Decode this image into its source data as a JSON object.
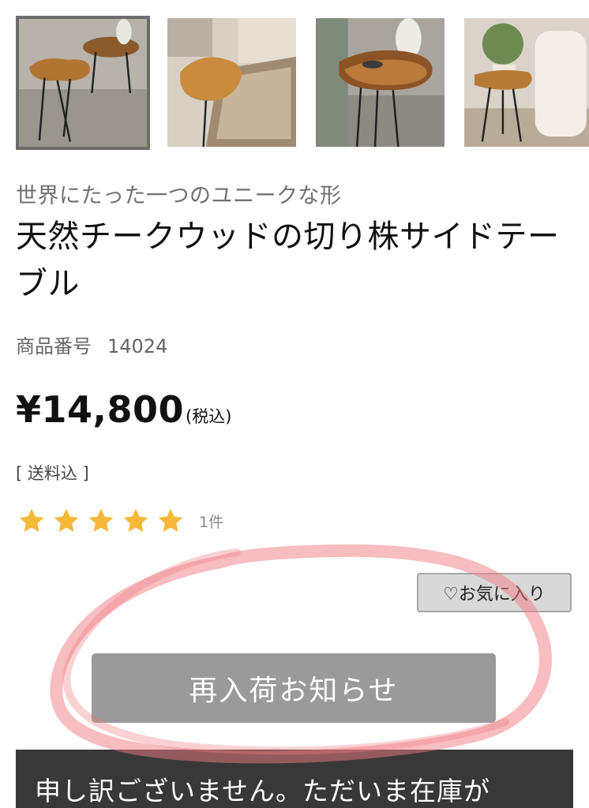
{
  "gallery": {
    "thumbnails": [
      {
        "icon": "photo-two-tables",
        "selected": true
      },
      {
        "icon": "photo-table-on-rug",
        "selected": false
      },
      {
        "icon": "photo-table-closeup",
        "selected": false
      },
      {
        "icon": "photo-table-with-person",
        "selected": false
      }
    ]
  },
  "product": {
    "subtitle": "世界にたった一つのユニークな形",
    "title": "天然チークウッドの切り株サイドテーブル",
    "number_label": "商品番号",
    "number": "14024",
    "price": "¥14,800",
    "tax_note": "(税込)",
    "shipping": "[ 送料込 ]",
    "rating": 5,
    "review_count": "1件"
  },
  "actions": {
    "favorite_label": "♡お気に入り",
    "restock_label": "再入荷お知らせ"
  },
  "notice": {
    "text": "申し訳ございません。ただいま在庫が"
  },
  "colors": {
    "star": "#f5b93a",
    "restock_button": "#9a9a9a",
    "notice_bg": "#383838",
    "annotation_circle": "#f27b82"
  }
}
